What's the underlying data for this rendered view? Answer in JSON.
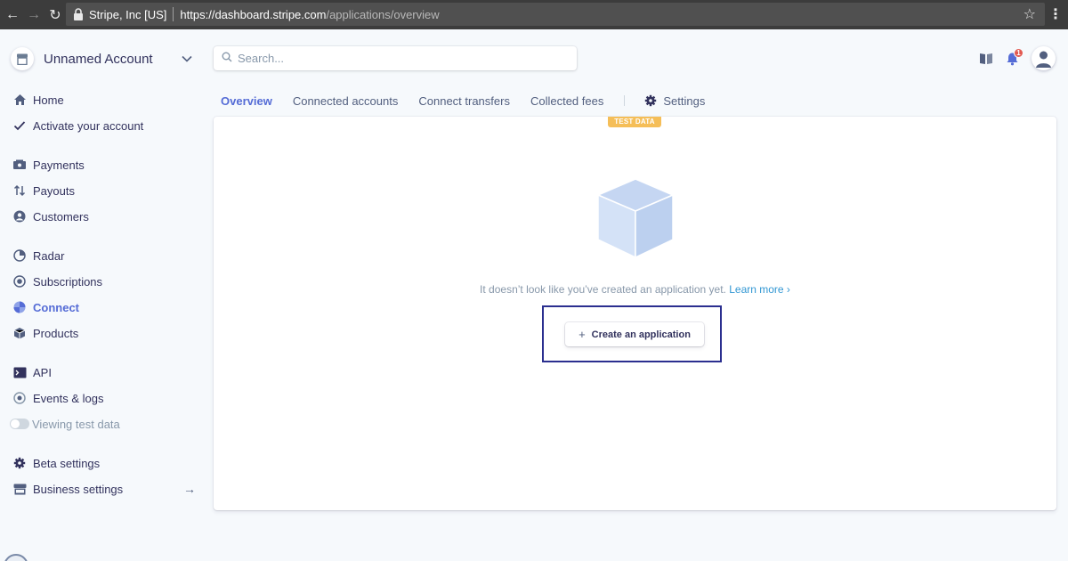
{
  "browser": {
    "site_name": "Stripe, Inc [US]",
    "url_host": "https://dashboard.stripe.com",
    "url_path": "/applications/overview"
  },
  "account": {
    "name": "Unnamed Account"
  },
  "search": {
    "placeholder": "Search..."
  },
  "notifications": {
    "count": "1"
  },
  "sidebar": {
    "items": [
      {
        "label": "Home",
        "icon": "home-icon"
      },
      {
        "label": "Activate your account",
        "icon": "check-icon"
      },
      {
        "label": "Payments",
        "icon": "payments-icon"
      },
      {
        "label": "Payouts",
        "icon": "payouts-icon"
      },
      {
        "label": "Customers",
        "icon": "customers-icon"
      },
      {
        "label": "Radar",
        "icon": "radar-icon"
      },
      {
        "label": "Subscriptions",
        "icon": "subscriptions-icon"
      },
      {
        "label": "Connect",
        "icon": "connect-icon",
        "active": true
      },
      {
        "label": "Products",
        "icon": "products-icon"
      },
      {
        "label": "API",
        "icon": "terminal-icon"
      },
      {
        "label": "Events & logs",
        "icon": "events-icon"
      },
      {
        "label": "Viewing test data",
        "icon": "toggle-icon"
      },
      {
        "label": "Beta settings",
        "icon": "gear-icon"
      },
      {
        "label": "Business settings",
        "icon": "store-icon"
      }
    ]
  },
  "tabs": [
    {
      "label": "Overview",
      "active": true
    },
    {
      "label": "Connected accounts"
    },
    {
      "label": "Connect transfers"
    },
    {
      "label": "Collected fees"
    }
  ],
  "settings_tab": {
    "label": "Settings"
  },
  "card": {
    "test_badge": "TEST DATA",
    "empty_message": "It doesn’t look like you’ve created an application yet.",
    "learn_more": "Learn more ›",
    "create_button": "Create an application",
    "create_button_plus": "+"
  },
  "colors": {
    "accent": "#556cd6",
    "link": "#3297d3",
    "test_badge": "#f5be58",
    "highlight_border": "#2b2f8f"
  }
}
